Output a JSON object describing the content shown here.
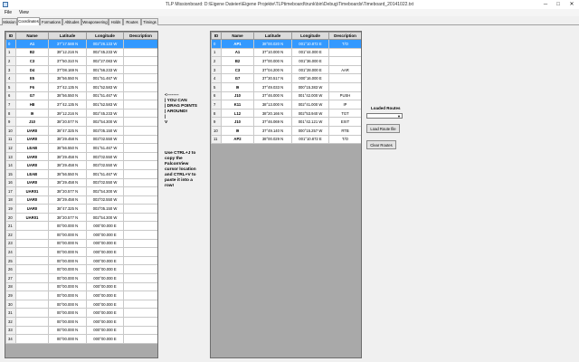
{
  "window": {
    "title": "TLP Missionboard: D:\\Eigene Dateien\\Eigene Projekte\\TLPtimeboard\\trunk\\bin\\Debug\\Timeboards\\Timeboard_20141022.txt",
    "minimize_glyph": "─",
    "maximize_glyph": "□",
    "close_glyph": "✕"
  },
  "menu": [
    "File",
    "View"
  ],
  "tabs": [
    {
      "label": "Mission",
      "active": false
    },
    {
      "label": "Coordinates",
      "active": true
    },
    {
      "label": "Formations",
      "active": false
    },
    {
      "label": "Altitudes",
      "active": false
    },
    {
      "label": "Weaponeering",
      "active": false
    },
    {
      "label": "Holds",
      "active": false
    },
    {
      "label": "Routes",
      "active": false
    },
    {
      "label": "Timings",
      "active": false
    }
  ],
  "grid_headers": [
    "ID",
    "Name",
    "Latitude",
    "Longitude",
    "Description"
  ],
  "left_rows": [
    [
      "0",
      "A1",
      "37°17.588 N",
      "002°26.133 W",
      ""
    ],
    [
      "1",
      "B2",
      "39°12.216 N",
      "002°45.233 W",
      ""
    ],
    [
      "2",
      "C3",
      "37°50.310 N",
      "002°27.083 W",
      ""
    ],
    [
      "3",
      "D4",
      "37°08.169 N",
      "001°56.233 W",
      ""
    ],
    [
      "4",
      "E5",
      "38°56.550 N",
      "001°51.467 W",
      ""
    ],
    [
      "5",
      "F6",
      "37°42.135 N",
      "001°52.583 W",
      ""
    ],
    [
      "6",
      "G7",
      "38°56.550 N",
      "001°51.467 W",
      ""
    ],
    [
      "7",
      "H8",
      "37°42.135 N",
      "001°52.583 W",
      ""
    ],
    [
      "8",
      "I9",
      "39°12.216 N",
      "002°45.233 W",
      ""
    ],
    [
      "9",
      "J10",
      "38°20.577 N",
      "002°54.300 W",
      ""
    ],
    [
      "10",
      "UAR0",
      "38°47.325 N",
      "003°05.150 W",
      ""
    ],
    [
      "11",
      "UAR0",
      "38°29.458 N",
      "003°02.550 W",
      ""
    ],
    [
      "12",
      "LEAB",
      "38°56.550 N",
      "001°51.467 W",
      ""
    ],
    [
      "13",
      "UAR0",
      "38°29.458 N",
      "003°02.550 W",
      ""
    ],
    [
      "14",
      "UAR0",
      "38°29.458 N",
      "003°02.550 W",
      ""
    ],
    [
      "15",
      "LEAB",
      "38°56.550 N",
      "001°51.467 W",
      ""
    ],
    [
      "16",
      "UAR0",
      "38°29.458 N",
      "003°02.550 W",
      ""
    ],
    [
      "17",
      "UAR01",
      "38°20.577 N",
      "002°54.300 W",
      ""
    ],
    [
      "18",
      "UAR0",
      "38°29.458 N",
      "003°02.550 W",
      ""
    ],
    [
      "19",
      "UAR0",
      "38°47.325 N",
      "003°05.150 W",
      ""
    ],
    [
      "20",
      "UAR01",
      "38°20.577 N",
      "002°54.300 W",
      ""
    ],
    [
      "21",
      "",
      "00°00.000 N",
      "000°00.000 E",
      ""
    ],
    [
      "22",
      "",
      "00°00.000 N",
      "000°00.000 E",
      ""
    ],
    [
      "23",
      "",
      "00°00.000 N",
      "000°00.000 E",
      ""
    ],
    [
      "24",
      "",
      "00°00.000 N",
      "000°00.000 E",
      ""
    ],
    [
      "25",
      "",
      "00°00.000 N",
      "000°00.000 E",
      ""
    ],
    [
      "26",
      "",
      "00°00.000 N",
      "000°00.000 E",
      ""
    ],
    [
      "27",
      "",
      "00°00.000 N",
      "000°00.000 E",
      ""
    ],
    [
      "28",
      "",
      "00°00.000 N",
      "000°00.000 E",
      ""
    ],
    [
      "29",
      "",
      "00°00.000 N",
      "000°00.000 E",
      ""
    ],
    [
      "30",
      "",
      "00°00.000 N",
      "000°00.000 E",
      ""
    ],
    [
      "31",
      "",
      "00°00.000 N",
      "000°00.000 E",
      ""
    ],
    [
      "32",
      "",
      "00°00.000 N",
      "000°00.000 E",
      ""
    ],
    [
      "33",
      "",
      "00°00.000 N",
      "000°00.000 E",
      ""
    ],
    [
      "34",
      "",
      "00°00.000 N",
      "000°00.000 E",
      ""
    ]
  ],
  "right_rows": [
    [
      "0",
      "AP1",
      "38°00.020 N",
      "001°10.872 E",
      "T/O"
    ],
    [
      "1",
      "A1",
      "37°10.000 N",
      "001°44.000 E",
      ""
    ],
    [
      "2",
      "B2",
      "37°00.000 N",
      "001°36.000 E",
      ""
    ],
    [
      "3",
      "C3",
      "37°04.200 N",
      "001°28.000 E",
      "AAR"
    ],
    [
      "4",
      "G7",
      "37°30.517 N",
      "000°16.000 E",
      ""
    ],
    [
      "5",
      "I9",
      "37°49.033 N",
      "000°15.383 W",
      ""
    ],
    [
      "6",
      "J10",
      "37°46.000 N",
      "001°42.000 W",
      "PUSH"
    ],
    [
      "7",
      "K11",
      "38°13.000 N",
      "002°41.000 W",
      "IP"
    ],
    [
      "8",
      "L12",
      "38°20.166 N",
      "002°53.940 W",
      "TGT"
    ],
    [
      "9",
      "J10",
      "37°46.069 N",
      "001°42.121 W",
      "EXIT"
    ],
    [
      "10",
      "I9",
      "37°49.140 N",
      "000°15.257 W",
      "RTB"
    ],
    [
      "11",
      "AP2",
      "38°00.029 N",
      "001°10.872 E",
      "T/O"
    ]
  ],
  "drag_note": "<--------\n| YOU CAN\n| DRAG POINTS\n| AROUND!\n|\nV",
  "copy_note": "Use CTRL+J to\ncopy the\nFalconView\ncursor location\nand CTRL+V to\npaste it into a\nrow!",
  "routes_panel": {
    "label": "Loaded Routes",
    "combo_value": "",
    "load_button": "Load Route file",
    "clear_button": "Clear Routes"
  }
}
